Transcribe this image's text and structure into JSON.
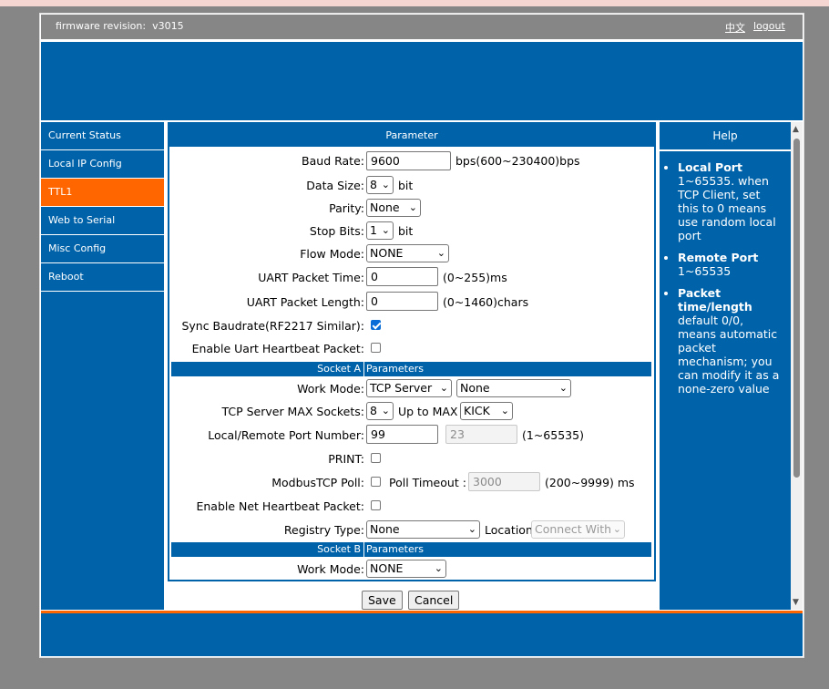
{
  "header": {
    "firmware_label": "firmware revision:",
    "firmware_value": "v3015",
    "lang_link": "中文",
    "logout_link": "logout"
  },
  "sidebar": {
    "items": [
      {
        "label": "Current Status"
      },
      {
        "label": "Local IP Config"
      },
      {
        "label": "TTL1",
        "active": true
      },
      {
        "label": "Web to Serial"
      },
      {
        "label": "Misc Config"
      },
      {
        "label": "Reboot"
      }
    ]
  },
  "form": {
    "title": "Parameter",
    "baud_rate": {
      "label": "Baud Rate:",
      "value": "9600",
      "unit": "bps(600~230400)bps"
    },
    "data_size": {
      "label": "Data Size:",
      "value": "8",
      "unit": "bit"
    },
    "parity": {
      "label": "Parity:",
      "value": "None"
    },
    "stop_bits": {
      "label": "Stop Bits:",
      "value": "1",
      "unit": "bit"
    },
    "flow_mode": {
      "label": "Flow Mode:",
      "value": "NONE"
    },
    "uart_packet_time": {
      "label": "UART Packet Time:",
      "value": "0",
      "unit": "(0~255)ms"
    },
    "uart_packet_length": {
      "label": "UART Packet Length:",
      "value": "0",
      "unit": "(0~1460)chars"
    },
    "sync_baudrate": {
      "label": "Sync Baudrate(RF2217 Similar):",
      "checked": true
    },
    "uart_heartbeat": {
      "label": "Enable Uart Heartbeat Packet:",
      "checked": false
    },
    "socket_a": {
      "section_left": "Socket A",
      "section_right": "Parameters",
      "work_mode": {
        "label": "Work Mode:",
        "value": "TCP Server",
        "value2": "None"
      },
      "max_sockets": {
        "label": "TCP Server MAX Sockets:",
        "value": "8",
        "middle": "Up to MAX",
        "value2": "KICK"
      },
      "port": {
        "label": "Local/Remote Port Number:",
        "local": "99",
        "remote": "23",
        "unit": "(1~65535)"
      },
      "print": {
        "label": "PRINT:",
        "checked": false
      },
      "modbus": {
        "label": "ModbusTCP Poll:",
        "checked": false,
        "timeout_label": "Poll Timeout :",
        "timeout_value": "3000",
        "unit": "(200~9999) ms"
      },
      "net_heartbeat": {
        "label": "Enable Net Heartbeat Packet:",
        "checked": false
      },
      "registry": {
        "label": "Registry Type:",
        "value": "None",
        "location_label": "Location",
        "location_value": "Connect With"
      }
    },
    "socket_b": {
      "section_left": "Socket B",
      "section_right": "Parameters",
      "work_mode": {
        "label": "Work Mode:",
        "value": "NONE"
      }
    }
  },
  "buttons": {
    "save": "Save",
    "cancel": "Cancel"
  },
  "help": {
    "title": "Help",
    "items": [
      {
        "term": "Local Port",
        "text": "1~65535. when TCP Client, set this to 0 means use random local port"
      },
      {
        "term": "Remote Port",
        "text": "1~65535"
      },
      {
        "term": "Packet time/length",
        "text": "default 0/0, means automatic packet mechanism; you can modify it as a none-zero value"
      }
    ]
  },
  "colors": {
    "primary": "#0063aa",
    "accent": "#ff6600",
    "background": "#868686"
  }
}
